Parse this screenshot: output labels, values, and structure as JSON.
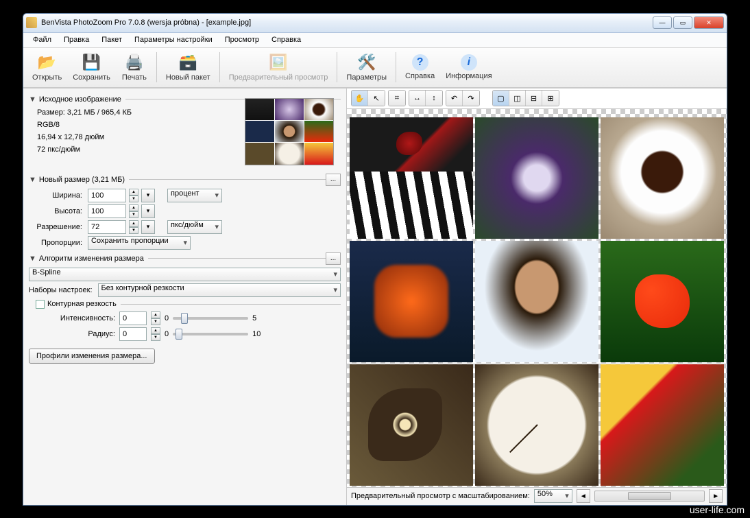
{
  "title": "BenVista PhotoZoom Pro 7.0.8 (wersja próbna) - [example.jpg]",
  "menu": [
    "Файл",
    "Правка",
    "Пакет",
    "Параметры настройки",
    "Просмотр",
    "Справка"
  ],
  "toolbar": {
    "open": "Открыть",
    "save": "Сохранить",
    "print": "Печать",
    "batch": "Новый пакет",
    "preview": "Предварительный просмотр",
    "params": "Параметры",
    "help": "Справка",
    "info": "Информация"
  },
  "left": {
    "source_hdr": "Исходное изображение",
    "size": "Размер: 3,21 МБ / 965,4 КБ",
    "mode": "RGB/8",
    "dims": "16,94 x 12,78 дюйм",
    "dpi_line": "72 пкс/дюйм",
    "newsize_hdr": "Новый размер (3,21 МБ)",
    "width_lbl": "Ширина:",
    "width_val": "100",
    "height_lbl": "Высота:",
    "height_val": "100",
    "unit_percent": "процент",
    "res_lbl": "Разрешение:",
    "res_val": "72",
    "unit_dpi": "пкс/дюйм",
    "prop_lbl": "Пропорции:",
    "prop_val": "Сохранить пропорции",
    "algo_hdr": "Алгоритм изменения размера",
    "algo_val": "B-Spline",
    "presets_lbl": "Наборы настроек:",
    "presets_val": "Без контурной резкости",
    "contour_chk": "Контурная резкость",
    "intensity_lbl": "Интенсивность:",
    "intensity_val": "0",
    "intensity_max": "5",
    "radius_lbl": "Радиус:",
    "radius_val": "0",
    "radius_max": "10",
    "profiles_btn": "Профили изменения размера..."
  },
  "status": {
    "preview_lbl": "Предварительный просмотр с масштабированием:",
    "zoom": "50%"
  },
  "watermark": "user-life.com"
}
